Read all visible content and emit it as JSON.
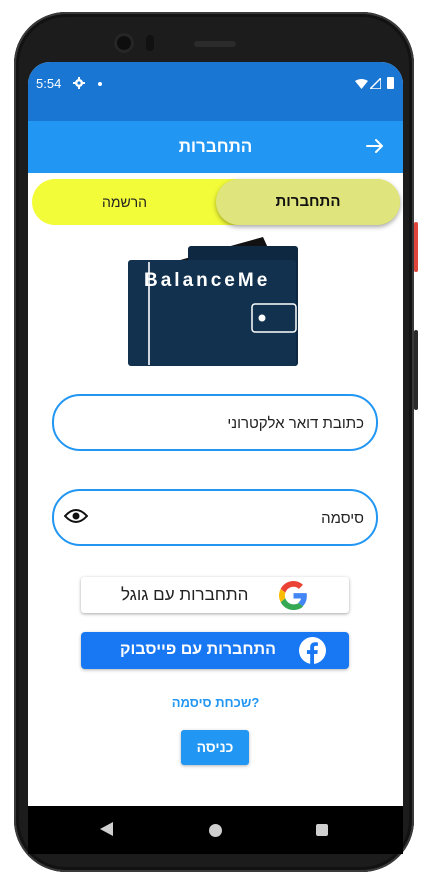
{
  "status_bar": {
    "time": "5:54"
  },
  "app_bar": {
    "title": "התחברות"
  },
  "tabs": {
    "login_label": "התחברות",
    "register_label": "הרשמה"
  },
  "logo": {
    "text": "BalanceMe"
  },
  "form": {
    "email_placeholder": "כתובת דואר אלקטרוני",
    "password_placeholder": "סיסמה"
  },
  "social": {
    "google_label": "התחברות עם גוגל",
    "facebook_label": "התחברות עם פייסבוק"
  },
  "forgot_password": "שכחת סיסמה?",
  "submit_label": "כניסה",
  "colors": {
    "status_bar": "#1976d2",
    "app_bar": "#2196f3",
    "toggle_bg": "#f2fc38",
    "toggle_active": "#dfe57c",
    "wallet": "#12314f",
    "facebook": "#1877f2"
  },
  "icons": [
    "gear-icon",
    "wifi-icon",
    "signal-icon",
    "battery-icon",
    "arrow-right-icon",
    "eye-icon",
    "google-icon",
    "facebook-icon"
  ]
}
